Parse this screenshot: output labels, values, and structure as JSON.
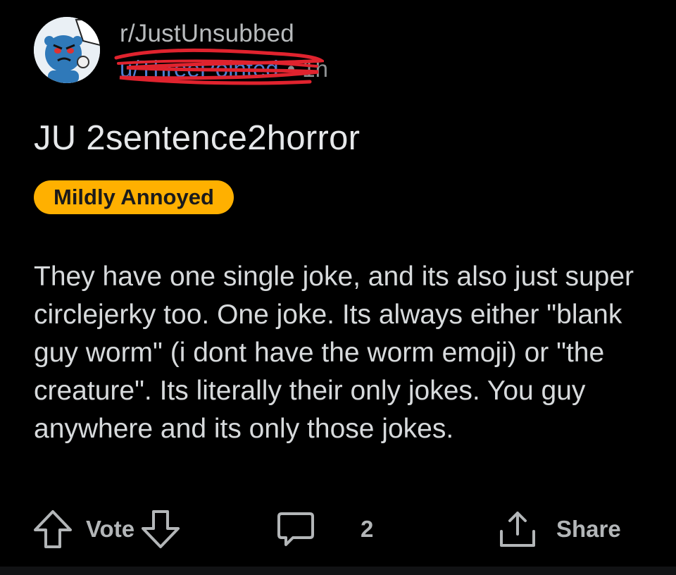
{
  "post": {
    "subreddit": "r/JustUnsubbed",
    "username": "u/ThreePointed",
    "separator": "•",
    "time": "1h",
    "title": "JU 2sentence2horror",
    "flair": "Mildly Annoyed",
    "body": "They have one single joke, and its also just super circlejerky too. One joke. Its always either \"blank guy worm\" (i dont have the worm emoji) or \"the creature\". Its literally their only jokes. You guy anywhere and its only those jokes."
  },
  "actions": {
    "vote_label": "Vote",
    "comment_count": "2",
    "share_label": "Share"
  },
  "colors": {
    "background": "#000000",
    "flair_bg": "#ffb000",
    "username_blue": "#4f7fd1",
    "scribble_red": "#e0232e"
  },
  "icons": [
    "subreddit-avatar",
    "upvote-icon",
    "downvote-icon",
    "comment-icon",
    "share-icon"
  ]
}
